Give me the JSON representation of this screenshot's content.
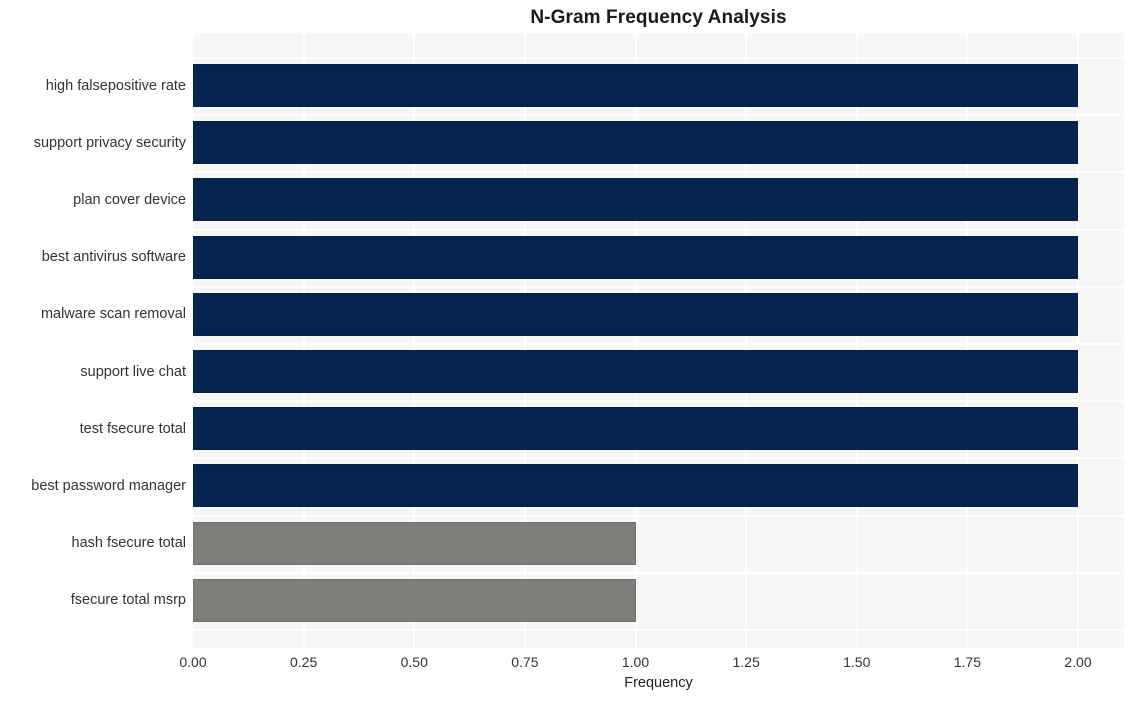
{
  "chart_data": {
    "type": "bar",
    "orientation": "horizontal",
    "title": "N-Gram Frequency Analysis",
    "xlabel": "Frequency",
    "ylabel": "",
    "categories": [
      "high falsepositive rate",
      "support privacy security",
      "plan cover device",
      "best antivirus software",
      "malware scan removal",
      "support live chat",
      "test fsecure total",
      "best password manager",
      "hash fsecure total",
      "fsecure total msrp"
    ],
    "values": [
      2,
      2,
      2,
      2,
      2,
      2,
      2,
      2,
      1,
      1
    ],
    "bar_colors": [
      "#05244f",
      "#05244f",
      "#05244f",
      "#05244f",
      "#05244f",
      "#05244f",
      "#05244f",
      "#05244f",
      "#7f7d79",
      "#7f7d79"
    ],
    "xlim": [
      0,
      2
    ],
    "xticks": [
      0,
      0.25,
      0.5,
      0.75,
      1,
      1.25,
      1.5,
      1.75,
      2
    ],
    "xtick_labels": [
      "0.00",
      "0.25",
      "0.50",
      "0.75",
      "1.00",
      "1.25",
      "1.50",
      "1.75",
      "2.00"
    ],
    "grid": true,
    "grid_color": "#ffffff",
    "legend": null,
    "plot_background": "#f7f7f7",
    "figure_background": "#ffffff"
  }
}
